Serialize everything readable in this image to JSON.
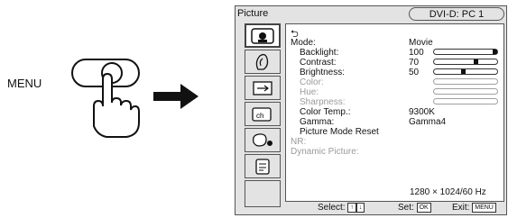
{
  "instruction": {
    "menu_label": "MENU"
  },
  "osd": {
    "title": "Picture",
    "input": "DVI-D: PC 1",
    "back_symbol": "⮌",
    "side_icons": [
      "picture-icon",
      "screen-icon",
      "menu-position-icon",
      "channel-icon",
      "eco-icon",
      "option-icon"
    ],
    "rows": {
      "mode": {
        "label": "Mode:",
        "value": "Movie"
      },
      "backlight": {
        "label": "Backlight:",
        "value": "100",
        "level": 1.0
      },
      "contrast": {
        "label": "Contrast:",
        "value": "70",
        "level": 0.7
      },
      "brightness": {
        "label": "Brightness:",
        "value": "50",
        "level": 0.5
      },
      "color": {
        "label": "Color:"
      },
      "hue": {
        "label": "Hue:"
      },
      "sharpness": {
        "label": "Sharpness:"
      },
      "color_temp": {
        "label": "Color  Temp.:",
        "value": "9300K"
      },
      "gamma": {
        "label": "Gamma:",
        "value": "Gamma4"
      },
      "picture_mode_reset": {
        "label": "Picture Mode Reset"
      },
      "nr": {
        "label": "NR:"
      },
      "dynamic_picture": {
        "label": "Dynamic Picture:"
      }
    },
    "resolution": "1280 × 1024/60 Hz",
    "status": {
      "select_label": "Select:",
      "select_keys": [
        "↑",
        "↓"
      ],
      "set_label": "Set:",
      "set_key": "OK",
      "exit_label": "Exit:",
      "exit_key": "MENU"
    }
  }
}
